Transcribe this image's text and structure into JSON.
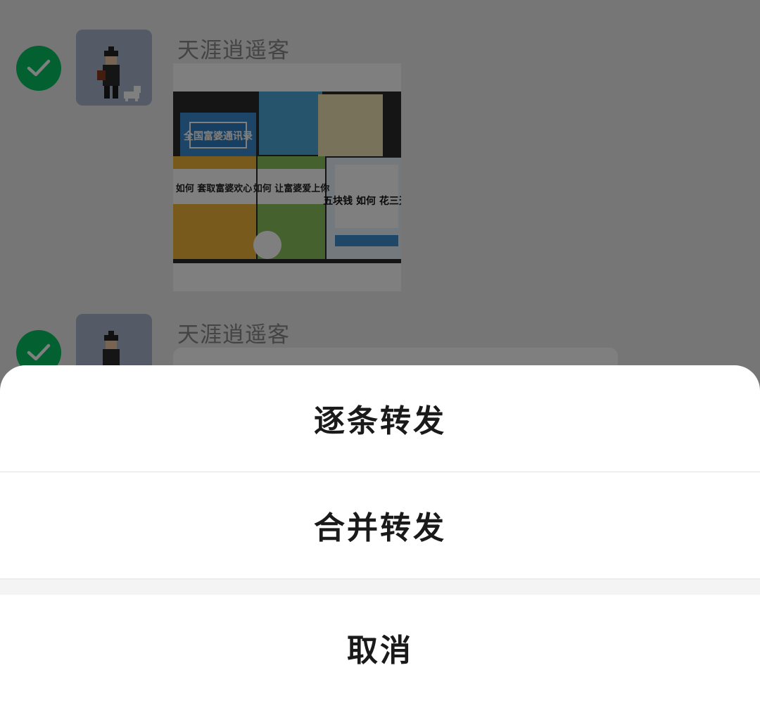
{
  "chat": {
    "messages": [
      {
        "sender": "天涯逍遥客",
        "type": "image",
        "image": {
          "books": [
            {
              "title": "全国富婆通讯录",
              "color": "#3b8bd0"
            },
            {
              "title": "",
              "color": "#4aa8d8"
            },
            {
              "title": "",
              "color": "#f3e4b6"
            },
            {
              "title": "如何 套取富婆欢心",
              "color": "#f2b43a"
            },
            {
              "title": "如何 让富婆爱上你",
              "color": "#8ac25a"
            },
            {
              "title": "五块钱 如何 花三天",
              "color": "#e8f2fb"
            }
          ]
        }
      },
      {
        "sender": "天涯逍遥客",
        "type": "text"
      }
    ]
  },
  "action_sheet": {
    "forward_one_by_one": "逐条转发",
    "merge_forward": "合并转发",
    "cancel": "取消"
  },
  "colors": {
    "check": "#07c160",
    "overlay": "rgba(0,0,0,0.5)"
  }
}
